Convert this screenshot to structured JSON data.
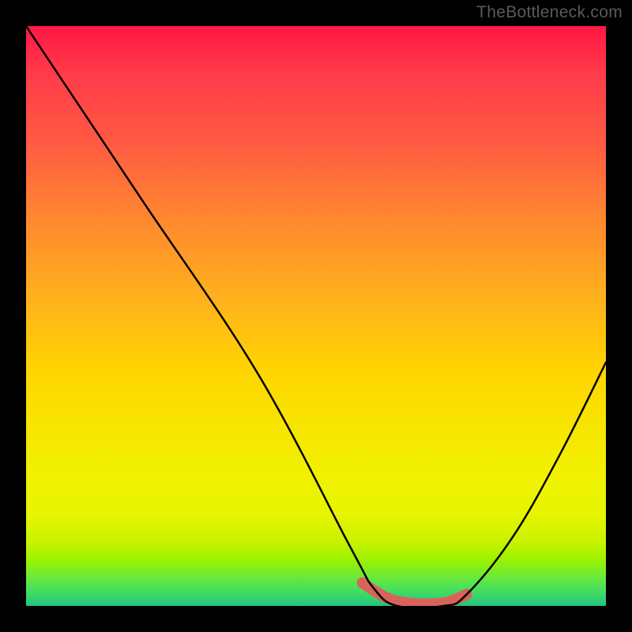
{
  "watermark": "TheBottleneck.com",
  "chart_data": {
    "type": "line",
    "title": "",
    "xlabel": "",
    "ylabel": "",
    "xlim": [
      0,
      100
    ],
    "ylim": [
      0,
      100
    ],
    "series": [
      {
        "name": "bottleneck-curve",
        "x": [
          0,
          4,
          20,
          40,
          56,
          60,
          64,
          72,
          76,
          84,
          92,
          100
        ],
        "values": [
          100,
          94,
          70,
          40,
          10,
          3,
          0,
          0,
          2,
          12,
          26,
          42
        ]
      }
    ],
    "highlight": {
      "name": "optimal-range",
      "x": [
        58,
        62,
        66,
        72,
        76
      ],
      "values": [
        4,
        1.5,
        0.5,
        0.5,
        2
      ],
      "color": "#d9635a"
    },
    "background_gradient": {
      "top": "#ff1744",
      "mid": "#ffd600",
      "bottom": "#1fc47c"
    }
  }
}
